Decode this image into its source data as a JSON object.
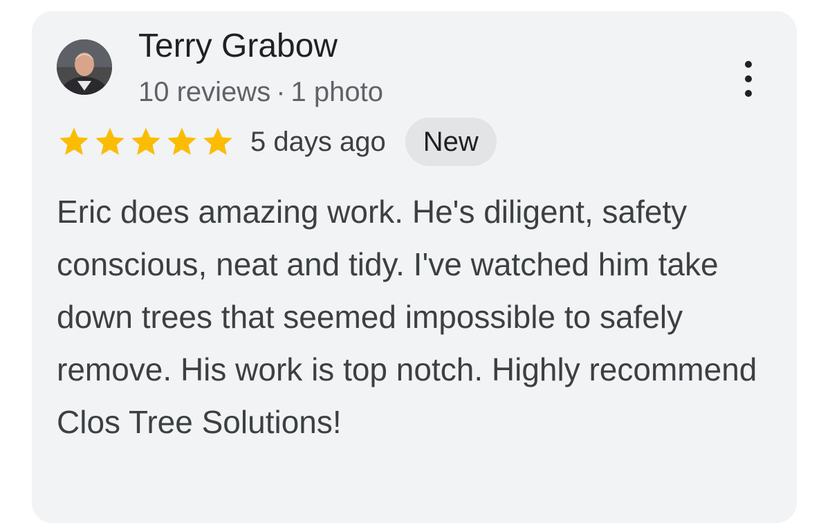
{
  "review": {
    "reviewer_name": "Terry Grabow",
    "reviews_count_text": "10 reviews",
    "separator": "·",
    "photos_count_text": "1 photo",
    "rating": 5,
    "rating_max": 5,
    "date_text": "5 days ago",
    "badge_text": "New",
    "text": "Eric does amazing work. He's diligent, safety conscious, neat and tidy. I've watched him take down trees that seemed impossible to safely remove. His work is top notch. Highly recommend Clos Tree Solutions!",
    "more_options_icon": "more-vertical-icon",
    "star_icon": "star-icon",
    "star_color": "#fbbc04"
  }
}
